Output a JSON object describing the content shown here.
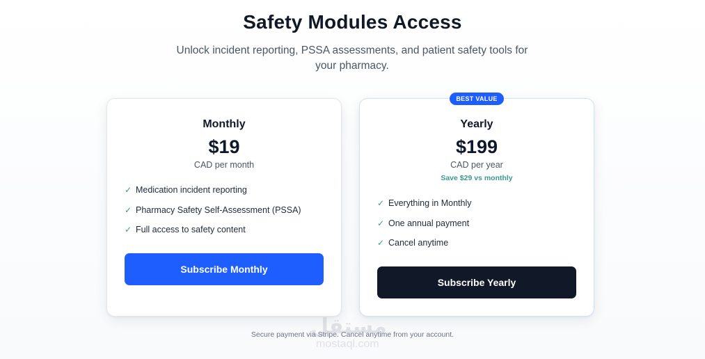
{
  "header": {
    "title": "Safety Modules Access",
    "subtitle": "Unlock incident reporting, PSSA assessments, and patient safety tools for your pharmacy."
  },
  "plans": [
    {
      "name": "Monthly",
      "price": "$19",
      "period": "CAD per month",
      "features": [
        "Medication incident reporting",
        "Pharmacy Safety Self-Assessment (PSSA)",
        "Full access to safety content"
      ],
      "button_label": "Subscribe Monthly",
      "button_color": "#1e5eff"
    },
    {
      "name": "Yearly",
      "badge": "BEST VALUE",
      "price": "$199",
      "period": "CAD per year",
      "savings": "Save $29 vs monthly",
      "features": [
        "Everything in Monthly",
        "One annual payment",
        "Cancel anytime"
      ],
      "button_label": "Subscribe Yearly",
      "button_color": "#111827"
    }
  ],
  "check_icon": "✓",
  "footer": "Secure payment via Stripe. Cancel anytime from your account.",
  "watermark": {
    "arabic": "مستقل",
    "latin": "mostaql.com"
  },
  "colors": {
    "accent": "#1e5eff",
    "check": "#3b9a8a",
    "dark_button": "#111827"
  }
}
